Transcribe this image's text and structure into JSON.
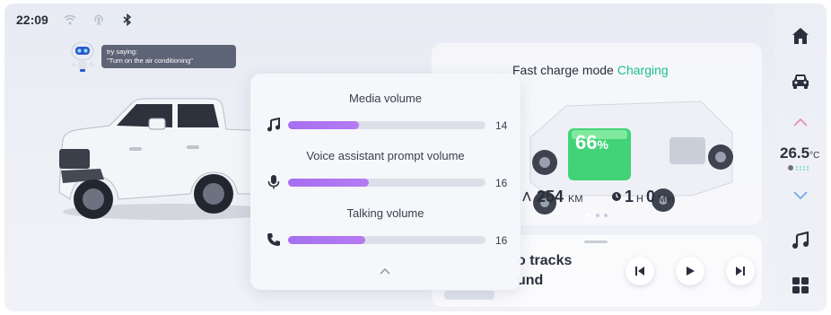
{
  "status_bar": {
    "time": "22:09",
    "icons": [
      "wifi-icon",
      "hotspot-icon",
      "bluetooth-icon"
    ]
  },
  "assistant": {
    "hint_line1": "try saying:",
    "hint_line2": "\"Turn on the air conditioning\""
  },
  "charge": {
    "title": "Fast charge mode",
    "status": "Charging",
    "percent": "66",
    "percent_unit": "%",
    "range_value": "254",
    "range_unit": "KM",
    "hours": "1",
    "hours_unit": "H",
    "minutes": "0",
    "minutes_unit": "Min",
    "battery_level": 0.66,
    "page_count": 3,
    "active_page": 0
  },
  "volume": {
    "items": [
      {
        "label": "Media volume",
        "value": "14",
        "level": 0.36,
        "icon": "music-note-icon"
      },
      {
        "label": "Voice assistant prompt volume",
        "value": "16",
        "level": 0.41,
        "icon": "microphone-icon"
      },
      {
        "label": "Talking volume",
        "value": "16",
        "level": 0.39,
        "icon": "phone-icon"
      }
    ]
  },
  "music": {
    "line1": "o tracks",
    "line2": "und",
    "controls": [
      "previous-icon",
      "play-icon",
      "next-icon"
    ]
  },
  "sidebar": {
    "temperature": "26.5",
    "temperature_unit": "°C",
    "items": [
      "home-icon",
      "car-icon",
      "chevron-up-icon",
      "chevron-down-icon",
      "music-icon",
      "apps-grid-icon"
    ]
  },
  "colors": {
    "accent_purple": "#a66ff0",
    "charging_green": "#1ec08a",
    "sidebar_up_arrow": "#e98db9",
    "sidebar_down_arrow": "#6fa8e8"
  }
}
